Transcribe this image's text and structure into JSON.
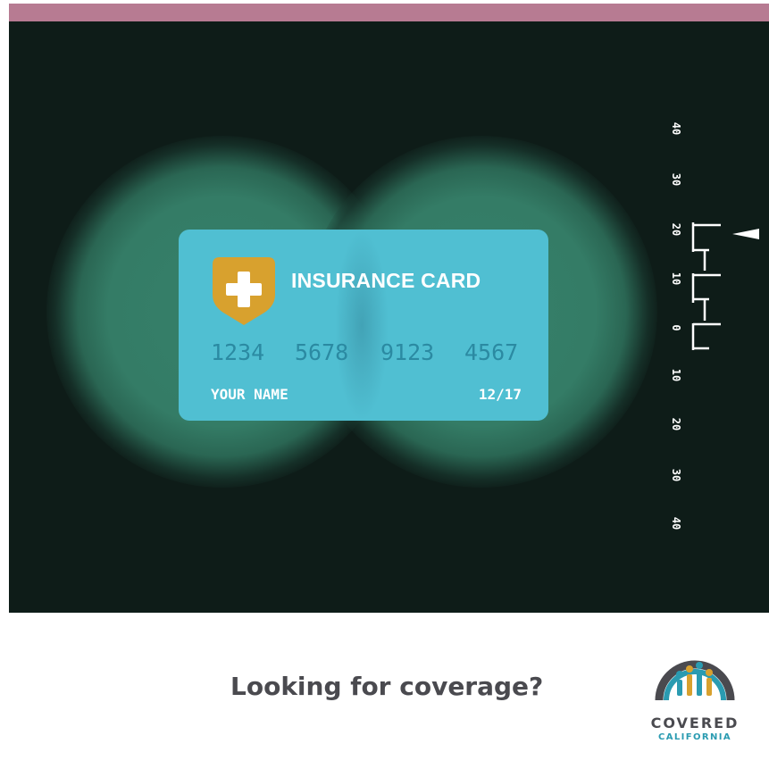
{
  "card": {
    "title": "INSURANCE CARD",
    "numbers": [
      "1234",
      "5678",
      "9123",
      "4567"
    ],
    "name": "YOUR NAME",
    "expiry": "12/17"
  },
  "ruler": {
    "labels": [
      "40",
      "30",
      "20",
      "10",
      "0",
      "10",
      "20",
      "30",
      "40"
    ]
  },
  "footer": {
    "question": "Looking for coverage?"
  },
  "logo": {
    "line1": "COVERED",
    "line2": "CALIFORNIA"
  },
  "colors": {
    "top_bar": "#b77b92",
    "background": "#0e1c18",
    "lens": "#36806a",
    "card": "#50bfd2",
    "shield": "#d8a12e",
    "card_number": "#2b8aa2",
    "footer_text": "#4a4a4f",
    "logo_teal": "#2a9bb1"
  },
  "icons": {
    "shield": "medical-cross-shield-icon",
    "indicator": "triangle-pointer-icon"
  }
}
